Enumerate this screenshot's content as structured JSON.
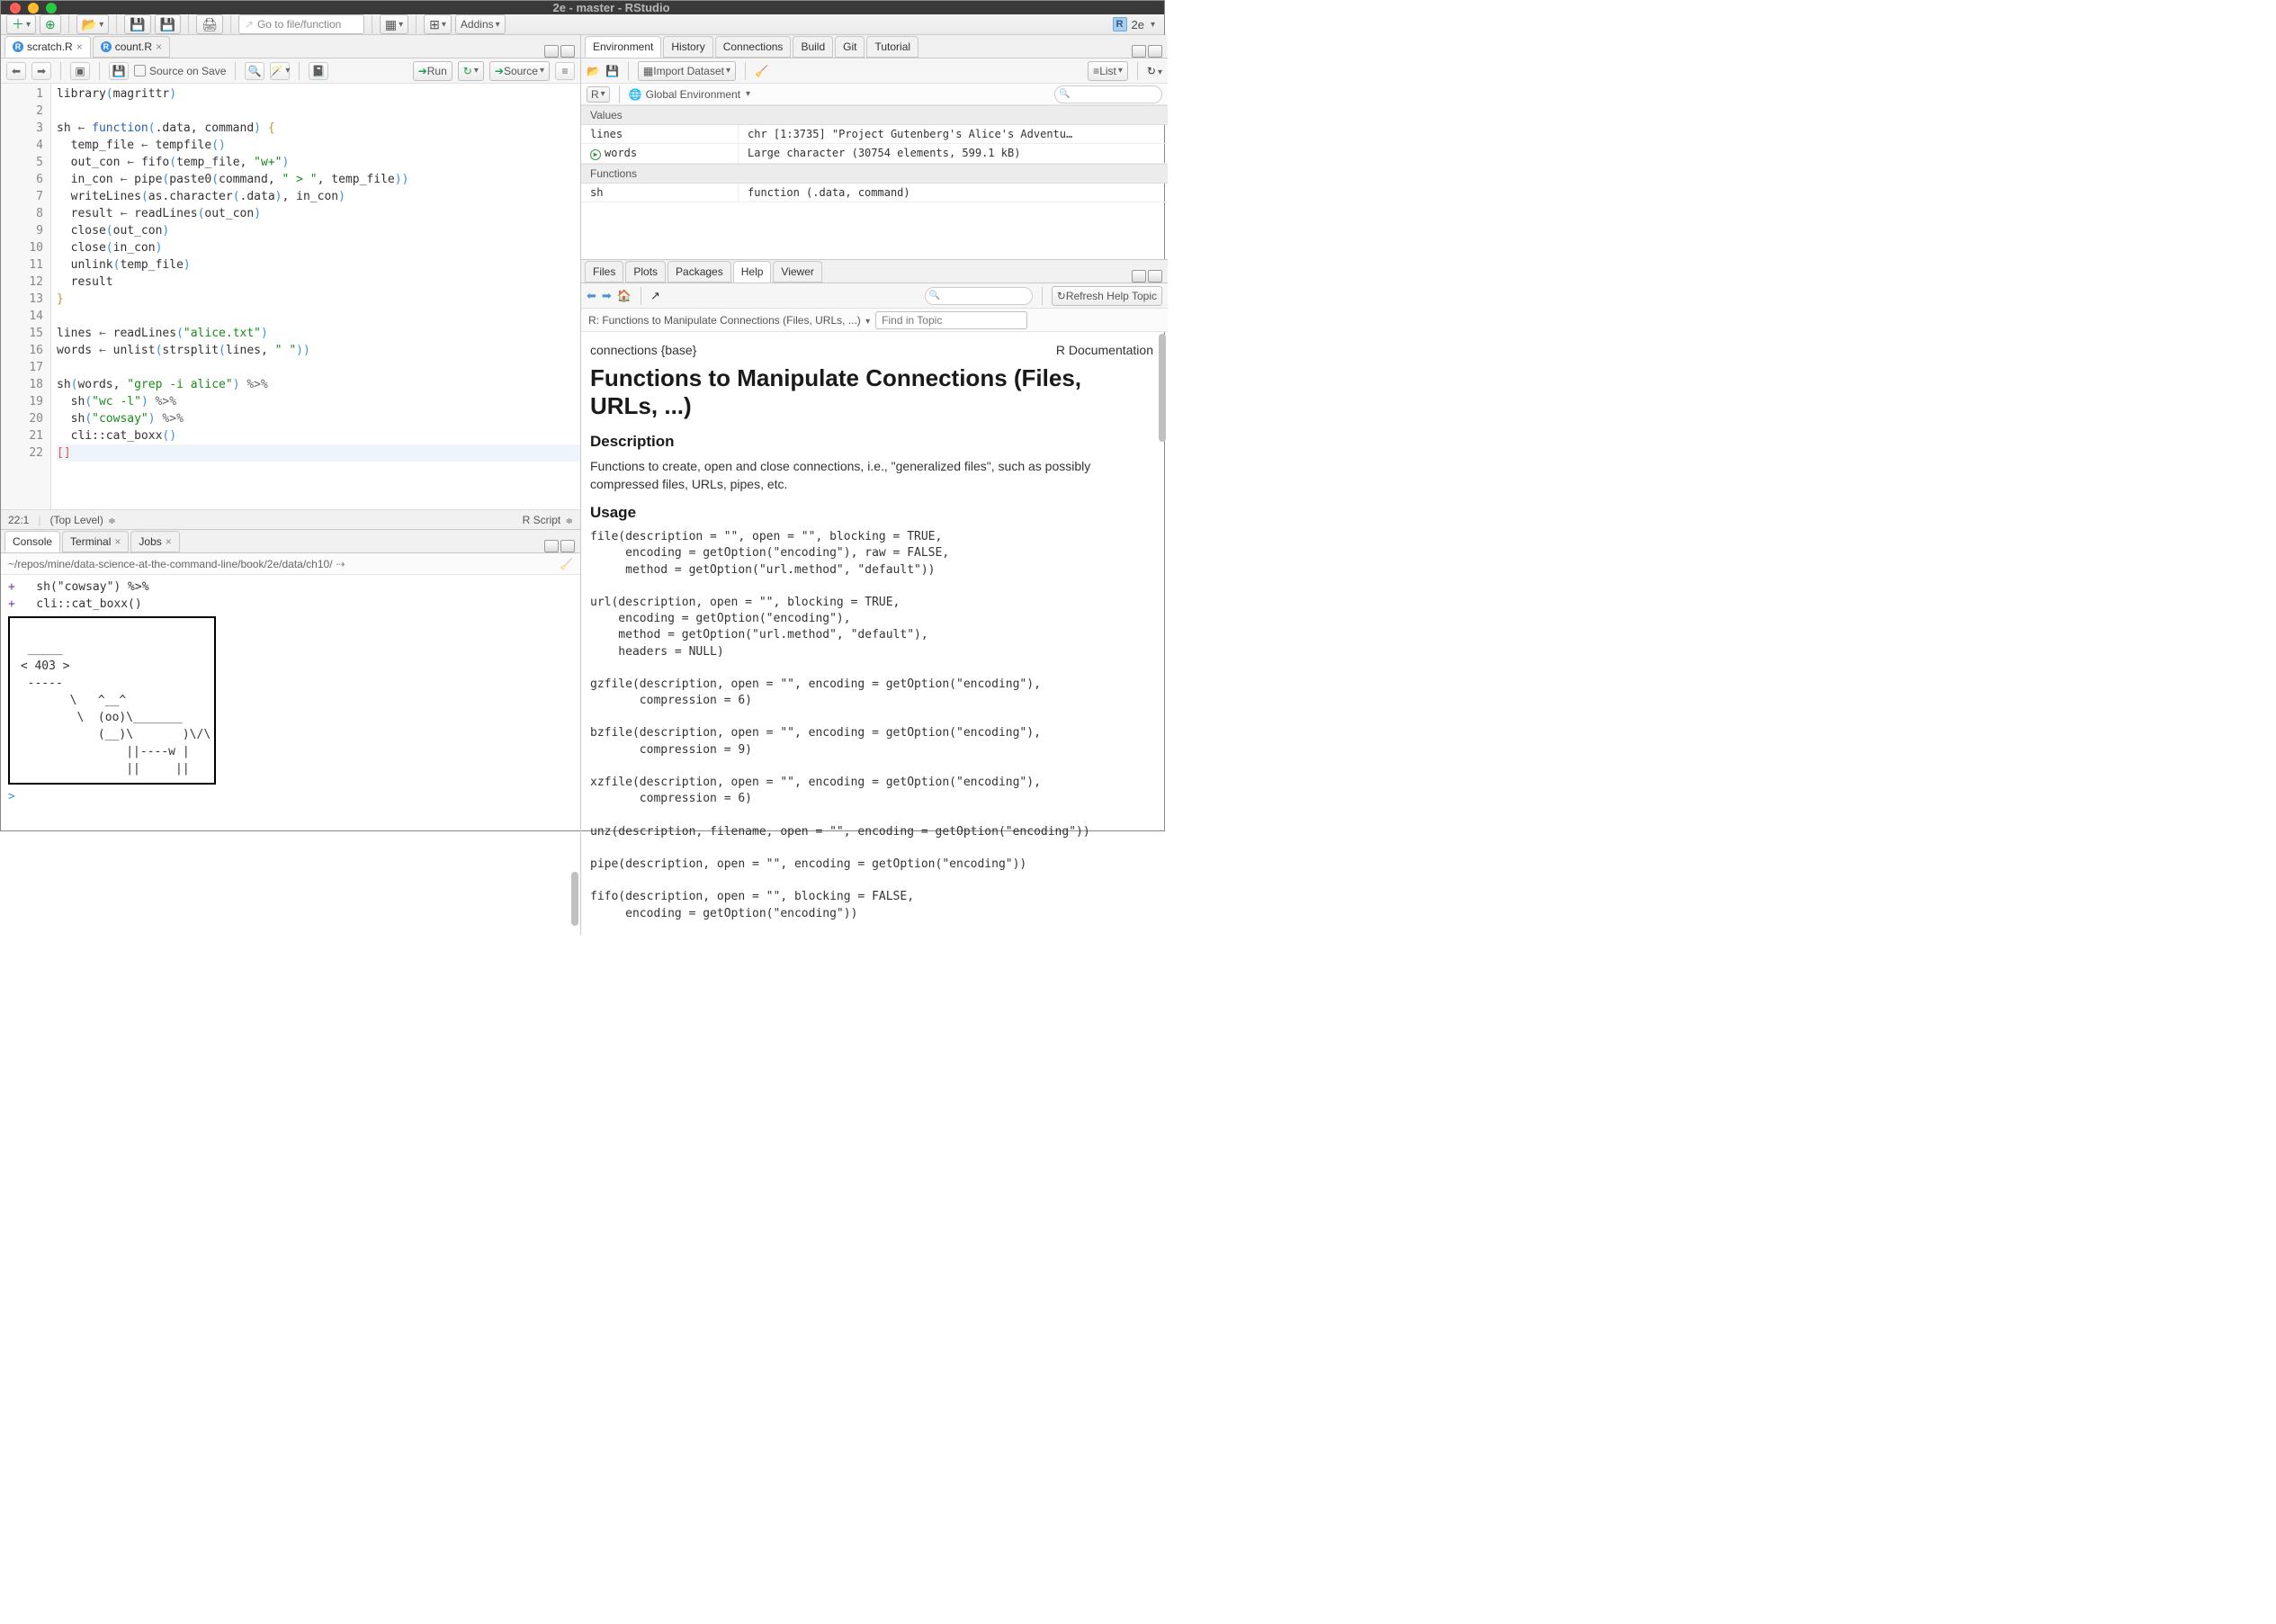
{
  "window": {
    "title": "2e - master - RStudio",
    "project": "2e"
  },
  "main_toolbar": {
    "goto_placeholder": "Go to file/function",
    "addins_label": "Addins"
  },
  "source": {
    "tabs": [
      {
        "icon": "R",
        "label": "scratch.R"
      },
      {
        "icon": "R",
        "label": "count.R"
      }
    ],
    "active_tab": 0,
    "source_on_save": "Source on Save",
    "run_label": "Run",
    "source_label": "Source",
    "status_pos": "22:1",
    "status_scope": "(Top Level)",
    "status_type": "R Script",
    "gutter": "    1\n    2\n    3\n    4\n    5\n    6\n    7\n    8\n    9\n   10\n   11\n   12\n   13\n   14\n   15\n   16\n   17\n   18\n   19\n   20\n   21\n   22",
    "code_lines": [
      "library(magrittr)",
      "",
      "sh <- function(.data, command) {",
      "  temp_file <- tempfile()",
      "  out_con <- fifo(temp_file, \"w+\")",
      "  in_con <- pipe(paste0(command, \" > \", temp_file))",
      "  writeLines(as.character(.data), in_con)",
      "  result <- readLines(out_con)",
      "  close(out_con)",
      "  close(in_con)",
      "  unlink(temp_file)",
      "  result",
      "}",
      "",
      "lines <- readLines(\"alice.txt\")",
      "words <- unlist(strsplit(lines, \" \"))",
      "",
      "sh(words, \"grep -i alice\") %>%",
      "  sh(\"wc -l\") %>%",
      "  sh(\"cowsay\") %>%",
      "  cli::cat_boxx()",
      "[]"
    ]
  },
  "console": {
    "tabs": [
      "Console",
      "Terminal",
      "Jobs"
    ],
    "active_tab": 0,
    "path": "~/repos/mine/data-science-at-the-command-line/book/2e/data/ch10/",
    "lines": [
      "+   sh(\"cowsay\") %>%",
      "+   cli::cat_boxx()"
    ],
    "cow": "\n  _____\n < 403 >\n  -----\n        \\   ^__^\n         \\  (oo)\\_______\n            (__)\\       )\\/\\\n                ||----w |\n                ||     ||\n",
    "prompt": ">"
  },
  "env": {
    "tabs": [
      "Environment",
      "History",
      "Connections",
      "Build",
      "Git",
      "Tutorial"
    ],
    "active_tab": 0,
    "import_label": "Import Dataset",
    "view_mode": "List",
    "scope_lang": "R",
    "scope_env": "Global Environment",
    "sections": [
      {
        "header": "Values",
        "rows": [
          {
            "name": "lines",
            "value": "chr [1:3735] \"Project Gutenberg's Alice's Adventu…",
            "play": false
          },
          {
            "name": "words",
            "value": "Large character (30754 elements,  599.1 kB)",
            "play": true
          }
        ]
      },
      {
        "header": "Functions",
        "rows": [
          {
            "name": "sh",
            "value": "function (.data, command)",
            "play": false
          }
        ]
      }
    ]
  },
  "help": {
    "tabs": [
      "Files",
      "Plots",
      "Packages",
      "Help",
      "Viewer"
    ],
    "active_tab": 3,
    "refresh_label": "Refresh Help Topic",
    "crumb": "R: Functions to Manipulate Connections (Files, URLs, ...)",
    "find_placeholder": "Find in Topic",
    "topic_name": "connections {base}",
    "topic_right": "R Documentation",
    "title": "Functions to Manipulate Connections (Files, URLs, ...)",
    "h2_desc": "Description",
    "desc_p": "Functions to create, open and close connections, i.e., \"generalized files\", such as possibly compressed files, URLs, pipes, etc.",
    "h2_usage": "Usage",
    "usage": "file(description = \"\", open = \"\", blocking = TRUE,\n     encoding = getOption(\"encoding\"), raw = FALSE,\n     method = getOption(\"url.method\", \"default\"))\n\nurl(description, open = \"\", blocking = TRUE,\n    encoding = getOption(\"encoding\"),\n    method = getOption(\"url.method\", \"default\"),\n    headers = NULL)\n\ngzfile(description, open = \"\", encoding = getOption(\"encoding\"),\n       compression = 6)\n\nbzfile(description, open = \"\", encoding = getOption(\"encoding\"),\n       compression = 9)\n\nxzfile(description, open = \"\", encoding = getOption(\"encoding\"),\n       compression = 6)\n\nunz(description, filename, open = \"\", encoding = getOption(\"encoding\"))\n\npipe(description, open = \"\", encoding = getOption(\"encoding\"))\n\nfifo(description, open = \"\", blocking = FALSE,\n     encoding = getOption(\"encoding\"))"
  }
}
